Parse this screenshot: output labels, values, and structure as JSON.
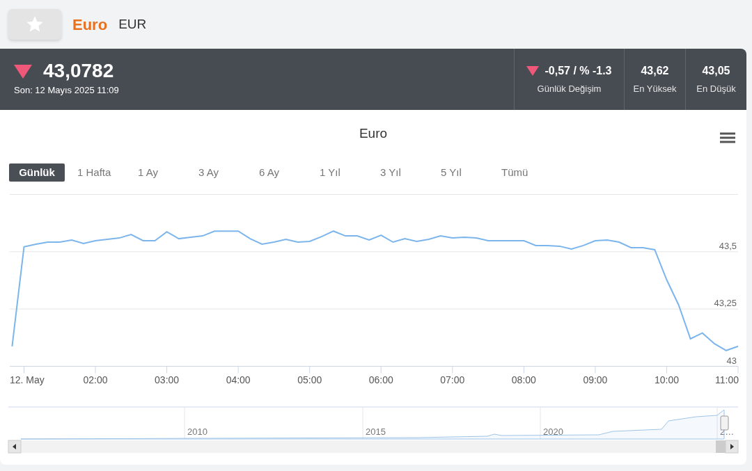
{
  "header": {
    "favorite": false,
    "name": "Euro",
    "code": "EUR"
  },
  "quote": {
    "falling": true,
    "price": "43,0782",
    "updated": "Son: 12 Mayıs 2025 11:09"
  },
  "stats": [
    {
      "kind": "change",
      "falling": true,
      "value": "-0,57 / % -1.3",
      "label": "Günlük Değişim"
    },
    {
      "kind": "plain",
      "value": "43,62",
      "label": "En Yüksek"
    },
    {
      "kind": "plain",
      "value": "43,05",
      "label": "En Düşük"
    }
  ],
  "chart": {
    "title": "Euro",
    "ranges": [
      {
        "label": "Günlük",
        "selected": true
      },
      {
        "label": "1 Hafta",
        "selected": false
      },
      {
        "label": "1 Ay",
        "selected": false
      },
      {
        "label": "3 Ay",
        "selected": false
      },
      {
        "label": "6 Ay",
        "selected": false
      },
      {
        "label": "1 Yıl",
        "selected": false
      },
      {
        "label": "3 Yıl",
        "selected": false
      },
      {
        "label": "5 Yıl",
        "selected": false
      },
      {
        "label": "Tümü",
        "selected": false
      }
    ],
    "chart_data": {
      "type": "line",
      "x": [
        0.833,
        1,
        1.167,
        1.333,
        1.5,
        1.667,
        1.833,
        2,
        2.167,
        2.333,
        2.5,
        2.667,
        2.833,
        3,
        3.167,
        3.333,
        3.5,
        3.667,
        3.833,
        4,
        4.167,
        4.333,
        4.5,
        4.667,
        4.833,
        5,
        5.167,
        5.333,
        5.5,
        5.667,
        5.833,
        6,
        6.167,
        6.333,
        6.5,
        6.667,
        6.833,
        7,
        7.167,
        7.333,
        7.5,
        7.667,
        7.833,
        8,
        8.167,
        8.333,
        8.5,
        8.667,
        8.833,
        9,
        9.167,
        9.333,
        9.5,
        9.667,
        9.833,
        10,
        10.167,
        10.333,
        10.5,
        10.667,
        10.833,
        11
      ],
      "series": [
        {
          "color": "#7cb5ec",
          "values": [
            43.087,
            43.521,
            43.533,
            43.542,
            43.542,
            43.551,
            43.536,
            43.548,
            43.554,
            43.56,
            43.575,
            43.548,
            43.548,
            43.587,
            43.557,
            43.563,
            43.569,
            43.59,
            43.59,
            43.59,
            43.557,
            43.533,
            43.542,
            43.554,
            43.542,
            43.545,
            43.566,
            43.59,
            43.569,
            43.569,
            43.551,
            43.572,
            43.542,
            43.557,
            43.545,
            43.554,
            43.569,
            43.56,
            43.563,
            43.56,
            43.548,
            43.548,
            43.548,
            43.548,
            43.527,
            43.527,
            43.524,
            43.512,
            43.527,
            43.548,
            43.551,
            43.542,
            43.518,
            43.518,
            43.509,
            43.377,
            43.268,
            43.12,
            43.145,
            43.099,
            43.069,
            43.087
          ]
        }
      ],
      "xlim": [
        0.8,
        11.0
      ],
      "xticks": [
        {
          "value": 1,
          "label": "12. May"
        },
        {
          "value": 2,
          "label": "02:00"
        },
        {
          "value": 3,
          "label": "03:00"
        },
        {
          "value": 4,
          "label": "04:00"
        },
        {
          "value": 5,
          "label": "05:00"
        },
        {
          "value": 6,
          "label": "06:00"
        },
        {
          "value": 7,
          "label": "07:00"
        },
        {
          "value": 8,
          "label": "08:00"
        },
        {
          "value": 9,
          "label": "09:00"
        },
        {
          "value": 10,
          "label": "10:00"
        },
        {
          "value": 11,
          "label": "11:00"
        }
      ],
      "ylim": [
        43.0,
        43.75
      ],
      "yticks": [
        {
          "value": 43,
          "label": "43"
        },
        {
          "value": 43.25,
          "label": "43,25"
        },
        {
          "value": 43.5,
          "label": "43,5"
        }
      ]
    },
    "navigator": {
      "labels": [
        "2010",
        "2015",
        "2020",
        "2…"
      ]
    }
  }
}
